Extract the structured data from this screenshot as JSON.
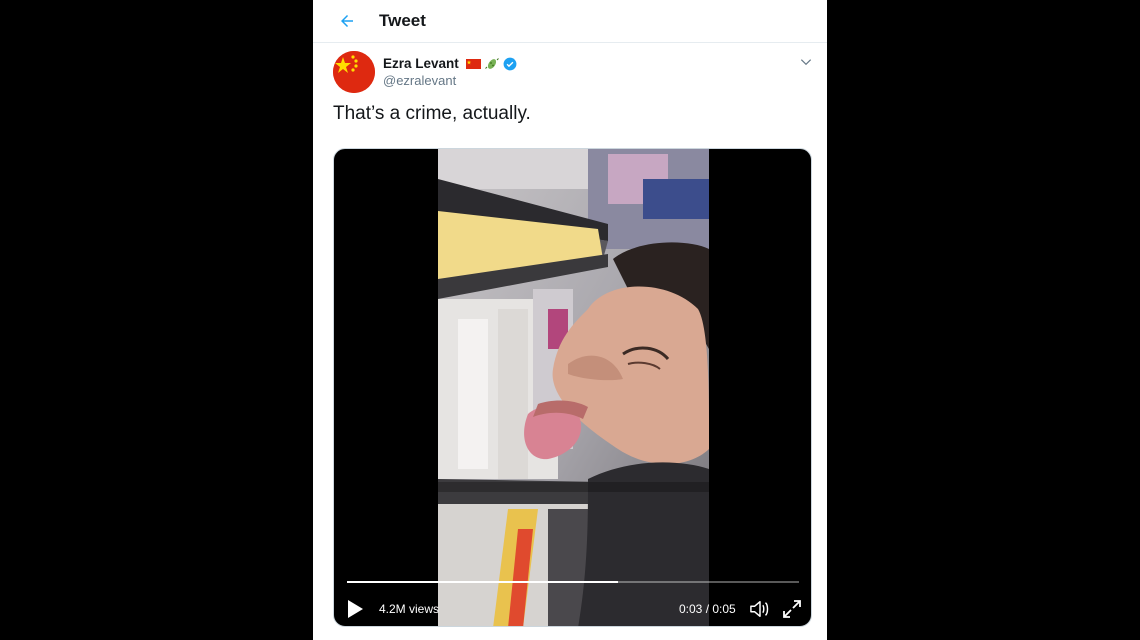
{
  "header": {
    "title": "Tweet",
    "back_icon": "arrow-left-icon"
  },
  "tweet": {
    "author": {
      "display_name": "Ezra Levant",
      "handle": "@ezralevant",
      "avatar": "china-flag-avatar",
      "name_emojis": [
        "china-flag-icon",
        "microbe-icon"
      ],
      "verified": true
    },
    "text": "That’s a crime, actually.",
    "menu_icon": "chevron-down-icon"
  },
  "video": {
    "views": "4.2M views",
    "time": "0:03 / 0:05",
    "progress": 0.6,
    "controls": [
      "play-icon",
      "volume-icon",
      "fullscreen-icon"
    ]
  },
  "colors": {
    "accent": "#1da1f2",
    "text": "#14171a",
    "secondary": "#657786",
    "background": "#000000"
  }
}
